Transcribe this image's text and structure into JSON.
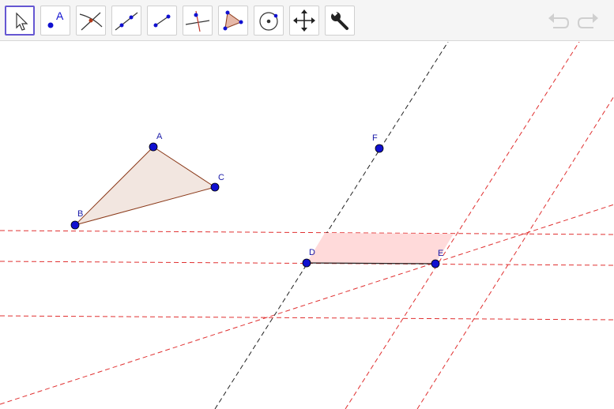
{
  "toolbar": {
    "tools": [
      {
        "name": "move-tool",
        "icon": "cursor-arrow-icon",
        "active": true
      },
      {
        "name": "point-tool",
        "icon": "point-icon",
        "glyph": "A"
      },
      {
        "name": "intersect-tool",
        "icon": "intersect-icon"
      },
      {
        "name": "line-tool",
        "icon": "line-through-points-icon"
      },
      {
        "name": "segment-tool",
        "icon": "segment-icon"
      },
      {
        "name": "perpendicular-tool",
        "icon": "perpendicular-line-icon"
      },
      {
        "name": "polygon-tool",
        "icon": "polygon-icon"
      },
      {
        "name": "circle-tool",
        "icon": "circle-center-point-icon"
      },
      {
        "name": "move-view-tool",
        "icon": "move-arrows-icon"
      },
      {
        "name": "tools-tool",
        "icon": "wrench-icon"
      }
    ],
    "undo_icon": "undo-icon",
    "redo_icon": "redo-icon"
  },
  "points": {
    "A": "A",
    "B": "B",
    "C": "C",
    "D": "D",
    "E": "E",
    "F": "F"
  },
  "colors": {
    "point": "#1010d0",
    "triangle_fill": "#f2e6e0",
    "triangle_stroke": "#8b3a1a",
    "parallelogram_fill": "#ffdada",
    "dashed_red": "#e03030",
    "dashed_black": "#222222",
    "active_border": "#6557d2"
  }
}
